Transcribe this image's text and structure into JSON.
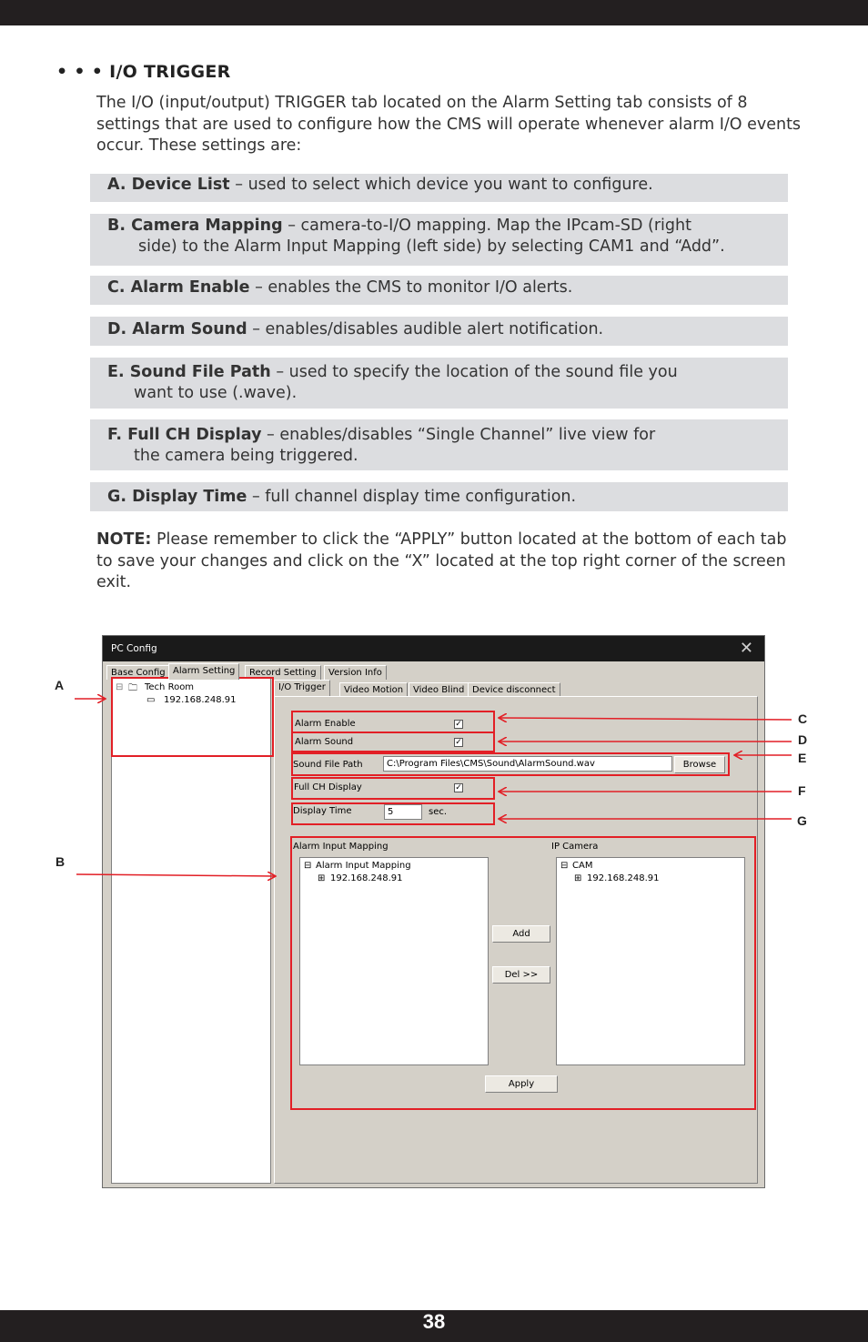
{
  "heading": "• • • I/O TRIGGER",
  "intro": "The I/O (input/output) TRIGGER tab located on the Alarm Setting tab consists of 8 settings that are used to configure how the CMS will operate whenever alarm I/O events occur. These settings are:",
  "settings": [
    {
      "label": "A.  Device List",
      "line1": " – used to select which device you want to configure.",
      "line2": ""
    },
    {
      "label": "B.  Camera Mapping",
      "line1": " – camera-to-I/O mapping. Map the IPcam-SD (right",
      "line2": "side) to the Alarm Input Mapping (left side) by selecting CAM1 and “Add”."
    },
    {
      "label": "C.  Alarm Enable",
      "line1": " – enables the CMS to monitor I/O alerts.",
      "line2": ""
    },
    {
      "label": "D.  Alarm Sound",
      "line1": " – enables/disables audible alert notification.",
      "line2": ""
    },
    {
      "label": "E.  Sound File Path",
      "line1": " – used to specify the location of the sound file you",
      "line2": "want to use (.wave)."
    },
    {
      "label": "F.  Full CH Display",
      "line1": " – enables/disables “Single Channel” live view for",
      "line2": "the camera being triggered."
    },
    {
      "label": "G. Display Time",
      "line1": " – full channel display time configuration.",
      "line2": ""
    }
  ],
  "note": {
    "label": "NOTE:",
    "text": " Please remember to click the “APPLY” button located at the bottom of each tab to save your changes and click on the “X” located at the top right corner of the screen exit."
  },
  "screenshot": {
    "window_title": "PC Config",
    "close_glyph": "✕",
    "main_tabs": [
      "Base Config",
      "Alarm Setting",
      "Record Setting",
      "Version Info"
    ],
    "sub_tabs": [
      "I/O Trigger",
      "Video Motion",
      "Video Blind",
      "Device disconnect"
    ],
    "tree": {
      "group": "Tech Room",
      "device": "192.168.248.91"
    },
    "alarm_enable_label": "Alarm Enable",
    "alarm_sound_label": "Alarm Sound",
    "sound_file_path_label": "Sound File Path",
    "sound_file_path_value": "C:\\Program Files\\CMS\\Sound\\AlarmSound.wav",
    "browse_label": "Browse",
    "full_ch_display_label": "Full CH Display",
    "display_time_label": "Display Time",
    "display_time_value": "5",
    "display_time_unit": "sec.",
    "check_glyph": "✓",
    "alarm_input_mapping_title": "Alarm Input Mapping",
    "alarm_input_tree_root": "Alarm Input Mapping",
    "alarm_input_tree_child": "192.168.248.91",
    "ip_camera_title": "IP Camera",
    "ip_camera_tree_root": "CAM",
    "ip_camera_tree_child": "192.168.248.91",
    "add_label": "Add",
    "del_label": "Del >>",
    "apply_label": "Apply"
  },
  "callouts": [
    "A",
    "B",
    "C",
    "D",
    "E",
    "F",
    "G"
  ],
  "page_number": "38",
  "colors": {
    "bar": "#231f20",
    "setting_bg": "#dcdde0",
    "annotation_red": "#e21f26"
  }
}
